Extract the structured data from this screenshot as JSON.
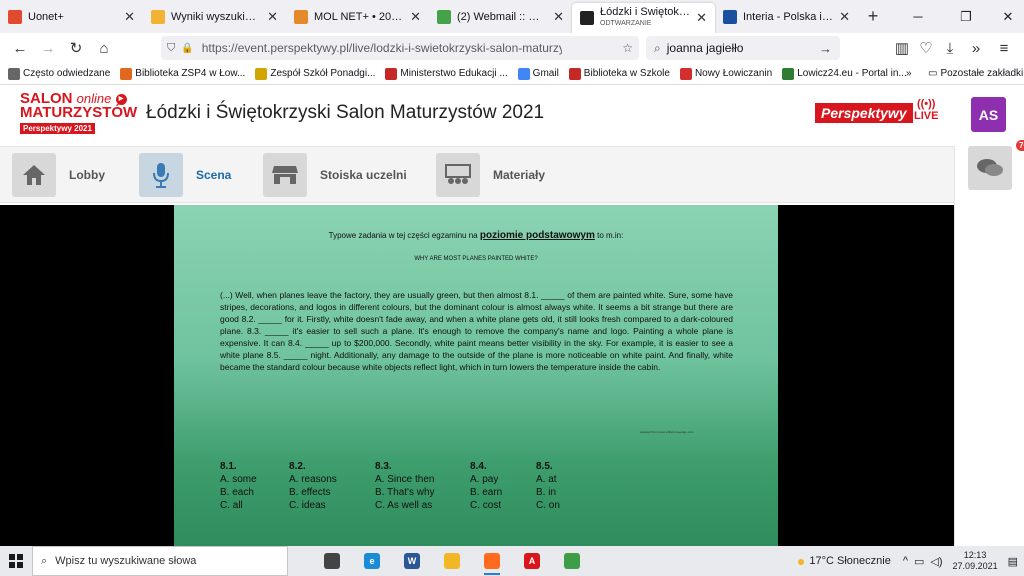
{
  "browser": {
    "tabs": [
      {
        "title": "Uonet+",
        "icon": "uonet-icon",
        "color": "#e04a2f"
      },
      {
        "title": "Wyniki wyszukiwania • M",
        "icon": "search-results-icon",
        "color": "#f2b233"
      },
      {
        "title": "MOL NET+ • 20.3.18.1868",
        "icon": "molnet-icon",
        "color": "#e48a2b"
      },
      {
        "title": "(2) Webmail :: Odebrane",
        "icon": "webmail-icon",
        "color": "#45a248"
      },
      {
        "title": "Łódzki i Świętokrzyski Salo",
        "subtitle": "ODTWARZANIE",
        "icon": "perspektywy-tab-icon",
        "color": "#222222",
        "active": true
      },
      {
        "title": "Interia - Polska i świat: inf",
        "icon": "interia-icon",
        "color": "#1a4fa0"
      }
    ],
    "url": "https://event.perspektywy.pl/live/lodzki-i-swietokrzyski-salon-maturzystow-2021/",
    "search_value": "joanna jagiełło",
    "bookmarks": [
      {
        "label": "Często odwiedzane",
        "color": "#666666"
      },
      {
        "label": "Biblioteka ZSP4 w Łow...",
        "color": "#e2681f"
      },
      {
        "label": "Zespół Szkół Ponadgi...",
        "color": "#d1a600"
      },
      {
        "label": "Ministerstwo Edukacji ...",
        "color": "#c62828"
      },
      {
        "label": "Gmail",
        "color": "#4285f4"
      },
      {
        "label": "Biblioteka w Szkole",
        "color": "#c62828"
      },
      {
        "label": "Nowy Łowiczanin",
        "color": "#d32f2f"
      },
      {
        "label": "Lowicz24.eu - Portal in...",
        "color": "#2e7d32"
      }
    ],
    "bookmarks_other": "Pozostałe zakładki"
  },
  "site": {
    "logo_line1": "SALON",
    "logo_online": "online",
    "logo_line2": "MATURZYSTÓW",
    "logo_line3": "Perspektywy 2021",
    "title": "Łódzki i Świętokrzyski Salon Maturzystów 2021",
    "brand": "Perspektywy",
    "live": "LIVE",
    "avatar": "AS",
    "chat_badge": "76",
    "nav": [
      {
        "label": "Lobby",
        "icon": "home-icon"
      },
      {
        "label": "Scena",
        "icon": "microphone-icon",
        "active": true
      },
      {
        "label": "Stoiska uczelni",
        "icon": "store-icon"
      },
      {
        "label": "Materiały",
        "icon": "materials-icon"
      }
    ]
  },
  "slide": {
    "intro_pre": "Typowe zadania w tej części egzaminu na",
    "intro_bold": "poziomie podstawowym",
    "intro_post": "to m.in:",
    "heading": "WHY ARE MOST PLANES PAINTED WHITE?",
    "passage": "(...) Well, when planes leave the factory, they are usually green, but then almost 8.1. _____ of them are painted white. Sure, some have stripes, decorations, and logos in different colours, but the dominant colour is almost always white. It seems a bit strange but there are good 8.2. _____ for it. Firstly, white doesn't fade away, and when a white plane gets old, it still looks fresh compared to a dark-coloured plane. 8.3. _____ it's easier to sell such a plane. It's enough to remove the company's name and logo. Painting a whole plane is expensive. It can 8.4. _____ up to $200,000. Secondly, white paint means better visibility in the sky. For example, it is easier to see a white plane 8.5. _____ night. Additionally, any damage to the outside of the plane is more noticeable on white paint. And finally, white became the standard colour because white objects reflect light, which in turn lowers the temperature inside the cabin.",
    "source": "adapted from www.whitehorseedge.com",
    "options": [
      {
        "num": "8.1.",
        "a": "A. some",
        "b": "B. each",
        "c": "C. all"
      },
      {
        "num": "8.2.",
        "a": "A. reasons",
        "b": "B. effects",
        "c": "C. ideas"
      },
      {
        "num": "8.3.",
        "a": "A. Since then",
        "b": "B. That's why",
        "c": "C. As well as"
      },
      {
        "num": "8.4.",
        "a": "A. pay",
        "b": "B. earn",
        "c": "C. cost"
      },
      {
        "num": "8.5.",
        "a": "A. at",
        "b": "B. in",
        "c": "C. on"
      }
    ]
  },
  "taskbar": {
    "search_placeholder": "Wpisz tu wyszukiwane słowa",
    "weather": "17°C  Słonecznie",
    "time": "12:13",
    "date": "27.09.2021",
    "apps": [
      {
        "name": "task-view-icon",
        "color": "#444444",
        "label": ""
      },
      {
        "name": "edge-icon",
        "color": "#1b8bd6",
        "label": "e"
      },
      {
        "name": "word-icon",
        "color": "#2b5797",
        "label": "W"
      },
      {
        "name": "file-explorer-icon",
        "color": "#f3b624",
        "label": ""
      },
      {
        "name": "firefox-icon",
        "color": "#ff6a1f",
        "label": "",
        "on": true
      },
      {
        "name": "acrobat-icon",
        "color": "#d7161d",
        "label": "A"
      },
      {
        "name": "chrome-icon",
        "color": "#3e9e47",
        "label": ""
      }
    ]
  }
}
